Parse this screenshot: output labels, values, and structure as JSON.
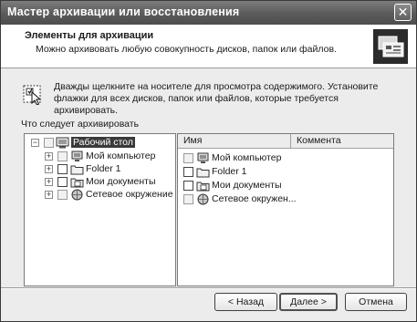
{
  "window": {
    "title": "Мастер архивации или восстановления"
  },
  "header": {
    "title": "Элементы для архивации",
    "subtitle": "Можно архивовать любую совокупность дисков, папок или файлов."
  },
  "hint": "Дважды щелкните на носителе для просмотра содержимого. Установите флажки для всех дисков, папок или файлов, которые требуется архивировать.",
  "tree": {
    "label": "Что следует архивировать",
    "root": {
      "label": "Рабочий стол",
      "icon": "desktop-icon"
    },
    "children": [
      {
        "label": "Мой компьютер",
        "icon": "computer-icon"
      },
      {
        "label": "Folder 1",
        "icon": "folder-icon"
      },
      {
        "label": "Мои документы",
        "icon": "documents-folder-icon"
      },
      {
        "label": "Сетевое окружение",
        "icon": "network-icon"
      }
    ]
  },
  "list": {
    "columns": [
      "Имя",
      "Коммента"
    ],
    "items": [
      {
        "name": "Мой компьютер",
        "icon": "computer-icon"
      },
      {
        "name": "Folder 1",
        "icon": "folder-icon"
      },
      {
        "name": "Мои документы",
        "icon": "documents-folder-icon"
      },
      {
        "name": "Сетевое окружен...",
        "icon": "network-icon"
      }
    ]
  },
  "buttons": {
    "back": "< Назад",
    "next": "Далее >",
    "cancel": "Отмена"
  }
}
